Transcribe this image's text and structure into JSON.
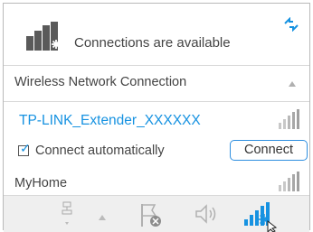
{
  "header": {
    "status_text": "Connections are available",
    "network_icon": "network-connections-icon",
    "refresh_icon": "refresh-icon"
  },
  "section": {
    "label": "Wireless Network Connection",
    "collapse_icon": "collapse-up-icon"
  },
  "networks": [
    {
      "name": "TP-LINK_Extender_XXXXXX",
      "signal_icon": "signal-bars-icon",
      "connect_automatically_label": "Connect automatically",
      "connect_automatically_checked": true,
      "connect_button_label": "Connect"
    },
    {
      "name": "MyHome",
      "signal_icon": "signal-bars-icon"
    }
  ],
  "taskbar": {
    "icons": [
      "network-drive-icon",
      "show-hidden-icons-arrow",
      "flag-icon",
      "speaker-icon",
      "wireless-signal-icon",
      "mouse-cursor"
    ]
  },
  "colors": {
    "accent_blue": "#1692e1",
    "text": "#444444",
    "border": "#b9b9b9",
    "taskbar_bg": "#efefef"
  }
}
